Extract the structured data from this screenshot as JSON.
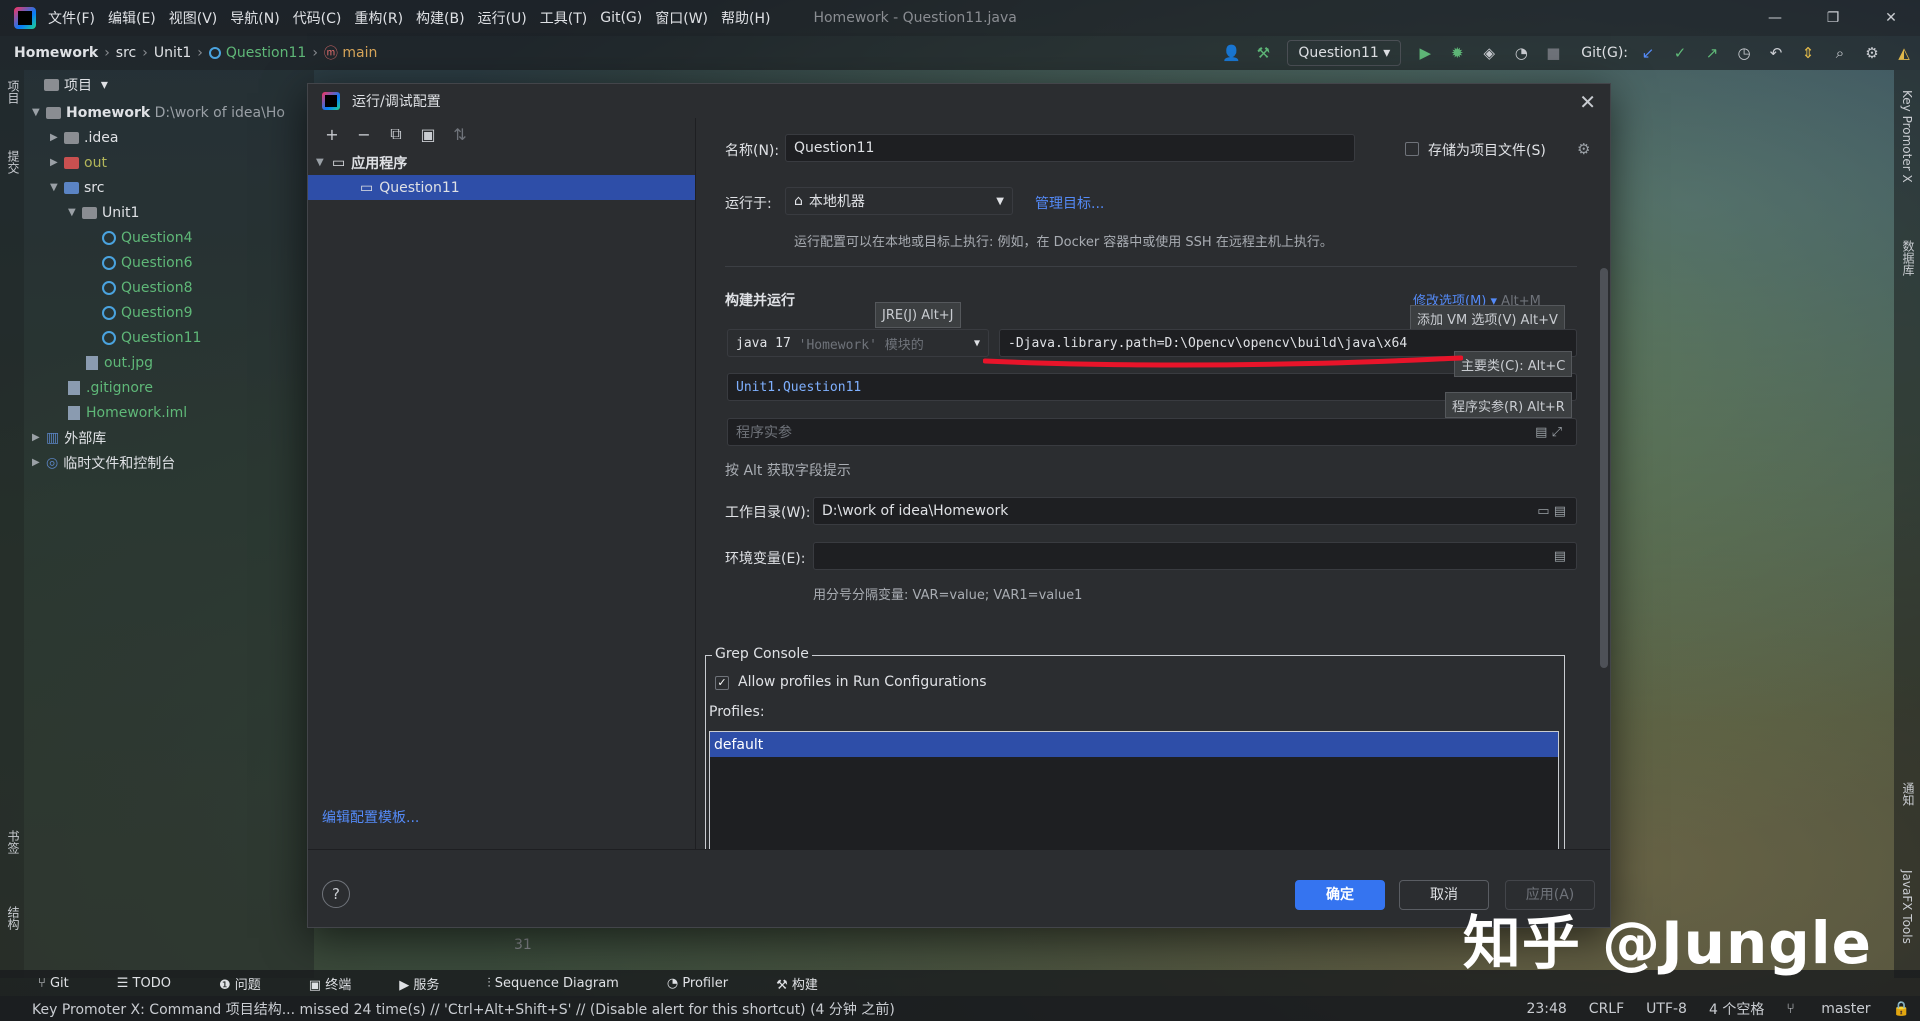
{
  "window": {
    "title": "Homework - Question11.java",
    "menu": [
      "文件(F)",
      "编辑(E)",
      "视图(V)",
      "导航(N)",
      "代码(C)",
      "重构(R)",
      "构建(B)",
      "运行(U)",
      "工具(T)",
      "Git(G)",
      "窗口(W)",
      "帮助(H)"
    ]
  },
  "breadcrumb": {
    "project": "Homework",
    "src": "src",
    "unit": "Unit1",
    "file": "Question11",
    "method": "main"
  },
  "toolbar": {
    "run_config": "Question11",
    "git_label": "Git(G):"
  },
  "strips": {
    "project": "项目",
    "commit": "提交",
    "bookmarks": "书签",
    "structure": "结构",
    "key_promoter": "Key Promoter X",
    "database": "数据库",
    "notifications": "通知",
    "javafx": "JavaFX Tools"
  },
  "project_panel": {
    "header": "项目",
    "root_name": "Homework",
    "root_path": "D:\\work of idea\\Ho",
    "idea": ".idea",
    "out": "out",
    "src": "src",
    "unit1": "Unit1",
    "classes": [
      "Question4",
      "Question6",
      "Question8",
      "Question9",
      "Question11"
    ],
    "out_jpg": "out.jpg",
    "gitignore": ".gitignore",
    "iml": "Homework.iml",
    "external_libs": "外部库",
    "scratches": "临时文件和控制台"
  },
  "dialog": {
    "title": "运行/调试配置",
    "tree_group": "应用程序",
    "tree_item": "Question11",
    "edit_templates": "编辑配置模板...",
    "name_label": "名称(N):",
    "name_value": "Question11",
    "store_as_file": "存储为项目文件(S)",
    "run_on_label": "运行于:",
    "run_on_value": "本地机器",
    "manage_targets": "管理目标...",
    "run_on_hint": "运行配置可以在本地或目标上执行: 例如，在 Docker 容器中或使用 SSH 在远程主机上执行。",
    "build_run": "构建并运行",
    "modify_options": "修改选项(M)",
    "modify_shortcut": "Alt+M",
    "jre_tooltip": "JRE(J) Alt+J",
    "jre_value": "java 17",
    "jre_detail": "'Homework' 模块的 ",
    "vm_options": "-Djava.library.path=D:\\Opencv\\opencv\\build\\java\\x64",
    "vm_tooltip": "添加 VM 选项(V) Alt+V",
    "main_class": "Unit1.Question11",
    "main_tooltip": "主要类(C): Alt+C",
    "args_tooltip": "程序实参(R) Alt+R",
    "args_placeholder": "程序实参",
    "alt_hint": "按 Alt 获取字段提示",
    "workdir_label": "工作目录(W):",
    "workdir_value": "D:\\work of idea\\Homework",
    "env_label": "环境变量(E):",
    "env_hint": "用分号分隔变量: VAR=value; VAR1=value1",
    "grep_title": "Grep Console",
    "allow_profiles": "Allow profiles in Run Configurations",
    "profiles_label": "Profiles:",
    "profiles": [
      "default"
    ],
    "ok": "确定",
    "cancel": "取消",
    "apply": "应用(A)"
  },
  "editor": {
    "line_number": "31"
  },
  "tool_windows": [
    "Git",
    "TODO",
    "问题",
    "终端",
    "服务",
    "Sequence Diagram",
    "Profiler",
    "构建"
  ],
  "status": {
    "message": "Key Promoter X: Command 项目结构... missed 24 time(s) // 'Ctrl+Alt+Shift+S' // (Disable alert for this shortcut) (4 分钟 之前)",
    "time": "23:48",
    "line_sep": "CRLF",
    "encoding": "UTF-8",
    "indent": "4 个空格",
    "branch": "master"
  },
  "watermark": "知乎 @Jungle",
  "colors": {
    "accent": "#3574f0",
    "selection": "#2e4ea8",
    "link": "#548af7",
    "annotation_red": "#e8142a"
  }
}
